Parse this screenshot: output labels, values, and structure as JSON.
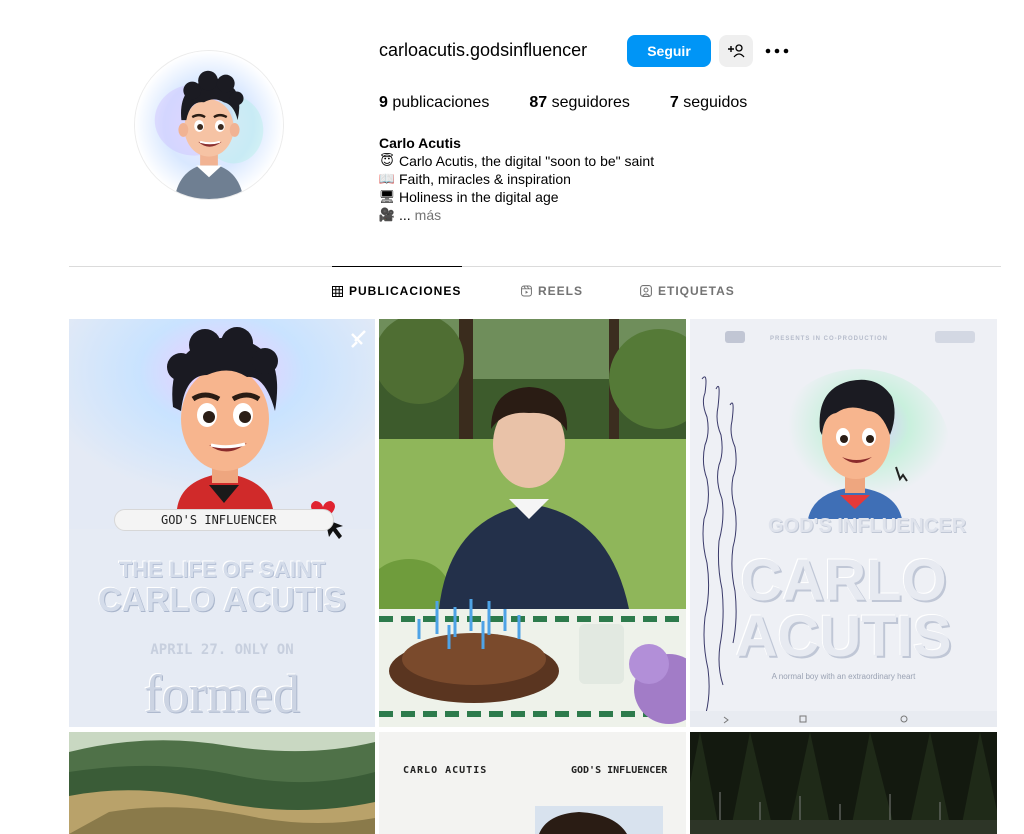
{
  "profile": {
    "username": "carloacutis.godsinfluencer",
    "follow_label": "Seguir",
    "more_icon": "more-options-icon",
    "suggest_icon": "add-person-icon"
  },
  "stats": {
    "posts_count": "9",
    "posts_label": "publicaciones",
    "followers_count": "87",
    "followers_label": "seguidores",
    "following_count": "7",
    "following_label": "seguidos"
  },
  "bio": {
    "name": "Carlo Acutis",
    "lines": [
      {
        "emoji": "😇",
        "text": "Carlo Acutis, the digital \"soon to be\" saint"
      },
      {
        "emoji": "📖",
        "text": "Faith, miracles & inspiration"
      },
      {
        "emoji": "🖥",
        "text": "Holiness in the digital age"
      },
      {
        "emoji": "🎥",
        "text": "..."
      }
    ],
    "more_label": "más"
  },
  "tabs": [
    {
      "label": "PUBLICACIONES",
      "icon": "grid-icon",
      "active": true
    },
    {
      "label": "REELS",
      "icon": "reels-icon",
      "active": false
    },
    {
      "label": "ETIQUETAS",
      "icon": "tagged-icon",
      "active": false
    }
  ],
  "posts": {
    "p1": {
      "badge": "GOD'S INFLUENCER",
      "line1": "THE LIFE OF SAINT",
      "line2": "CARLO ACUTIS",
      "date": "APRIL 27. ONLY ON",
      "brand": "formed",
      "pinned_icon": "pin-icon"
    },
    "p3": {
      "header": "PRESENTS IN CO-PRODUCTION",
      "subtitle": "GOD'S INFLUENCER",
      "title1": "CARLO",
      "title2": "ACUTIS",
      "tagline": "A normal boy with an extraordinary heart"
    },
    "p5": {
      "left": "CARLO ACUTIS",
      "right": "GOD'S INFLUENCER"
    }
  },
  "colors": {
    "accent": "#0095f6",
    "secondary_text": "#737373",
    "divider": "#dbdbdb"
  }
}
